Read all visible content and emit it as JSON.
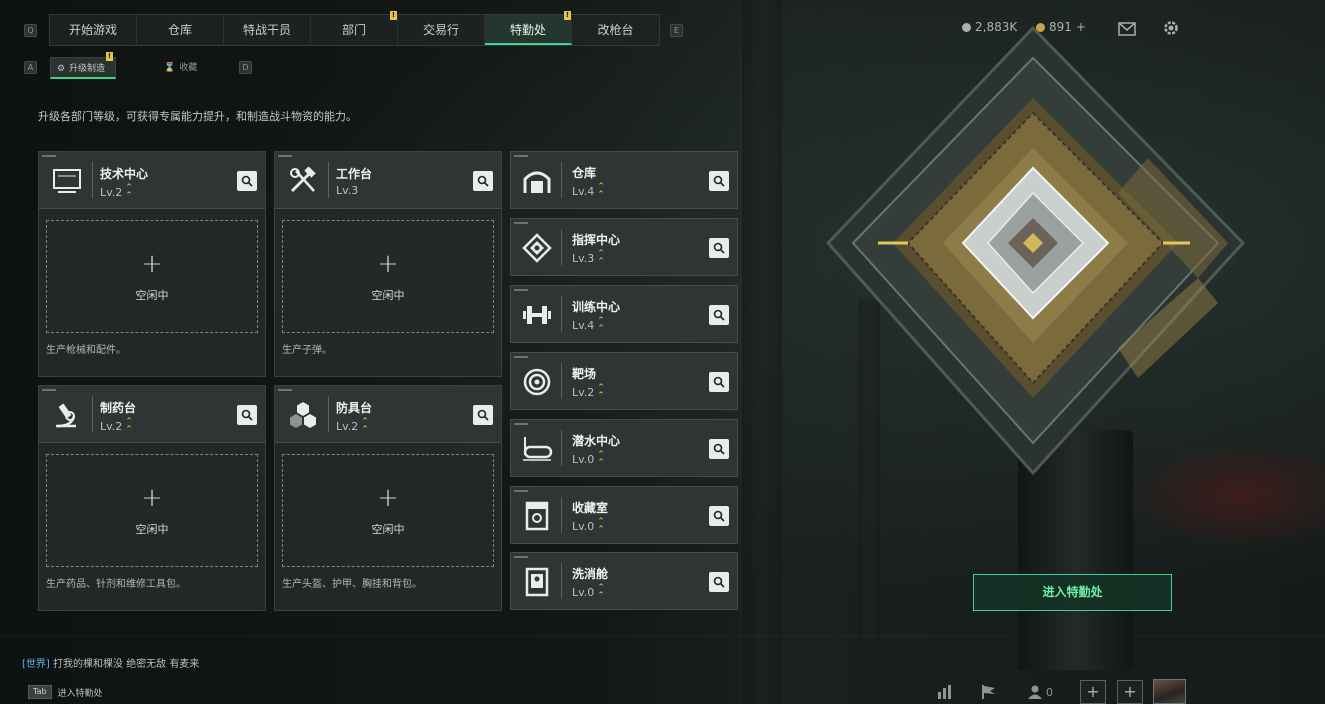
{
  "nav": {
    "left_key": "Q",
    "right_key": "E",
    "tabs": [
      {
        "label": "开始游戏",
        "badge": ""
      },
      {
        "label": "仓库",
        "badge": ""
      },
      {
        "label": "特战干员",
        "badge": ""
      },
      {
        "label": "部门",
        "badge": "!"
      },
      {
        "label": "交易行",
        "badge": ""
      },
      {
        "label": "特勤处",
        "badge": "!",
        "active": true
      },
      {
        "label": "改枪台",
        "badge": ""
      }
    ],
    "currency1": "2,883K",
    "currency2": "891",
    "currency2_plus": "+"
  },
  "subnav": {
    "left_key": "A",
    "right_key": "D",
    "tab1": "升级制造",
    "tab1_badge": "!",
    "tab2": "收藏"
  },
  "description": "升级各部门等级，可获得专属能力提升，和制造战斗物资的能力。",
  "large_cards": [
    {
      "title": "技术中心",
      "level": "Lv.2",
      "slot_plus": "+",
      "slot_status": "空闲中",
      "produce": "生产枪械和配件。",
      "icon": "monitor-icon"
    },
    {
      "title": "工作台",
      "level": "Lv.3",
      "slot_plus": "+",
      "slot_status": "空闲中",
      "produce": "生产子弹。",
      "icon": "tools-icon"
    },
    {
      "title": "制药台",
      "level": "Lv.2",
      "slot_plus": "+",
      "slot_status": "空闲中",
      "produce": "生产药品、针剂和维修工具包。",
      "icon": "microscope-icon"
    },
    {
      "title": "防具台",
      "level": "Lv.2",
      "slot_plus": "+",
      "slot_status": "空闲中",
      "produce": "生产头盔、护甲、胸挂和背包。",
      "icon": "hexagons-icon"
    }
  ],
  "small_cards": [
    {
      "title": "仓库",
      "level": "Lv.4",
      "icon": "garage-icon"
    },
    {
      "title": "指挥中心",
      "level": "Lv.3",
      "icon": "command-chip-icon"
    },
    {
      "title": "训练中心",
      "level": "Lv.4",
      "icon": "dumbbell-icon"
    },
    {
      "title": "靶场",
      "level": "Lv.2",
      "icon": "target-icon"
    },
    {
      "title": "潜水中心",
      "level": "Lv.0",
      "icon": "diving-mask-icon"
    },
    {
      "title": "收藏室",
      "level": "Lv.0",
      "icon": "display-case-icon"
    },
    {
      "title": "洗消舱",
      "level": "Lv.0",
      "icon": "decon-chamber-icon"
    }
  ],
  "enter_button": "进入特勤处",
  "chat": {
    "channel": "[世界]",
    "sender": "打我的棵和棵没",
    "message": "绝密无敌 有麦来"
  },
  "tab_hint": {
    "key": "Tab",
    "label": "进入特勤处"
  },
  "bottom": {
    "friends_count": "0",
    "plus1": "+",
    "plus2": "+"
  },
  "colors": {
    "accent_green": "#3fd28a",
    "level_arrow": "#e9c24a",
    "badge": "#e6c34a"
  }
}
